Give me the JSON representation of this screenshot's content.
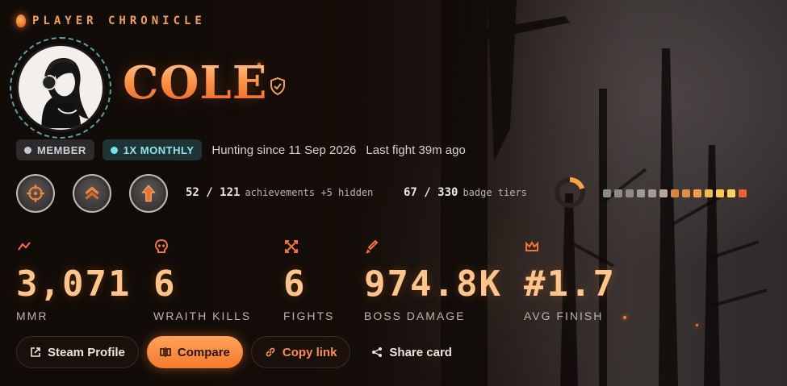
{
  "header": {
    "eyebrow": "PLAYER CHRONICLE"
  },
  "player": {
    "name": "COLE",
    "verified_icon": "shield-check-icon"
  },
  "pills": {
    "member": "MEMBER",
    "monthly": "1X MONTHLY",
    "since": "Hunting since 11 Sep 2026",
    "last_fight": "Last fight 39m ago"
  },
  "badges": [
    {
      "icon": "crosshair-icon"
    },
    {
      "icon": "chevron-rank-icon"
    },
    {
      "icon": "arrow-up-icon"
    }
  ],
  "achievements": {
    "count": "52 / 121",
    "label": "achievements +5 hidden"
  },
  "badge_tiers": {
    "count": "67 / 330",
    "label": "badge tiers",
    "progress": 0.2
  },
  "tier_colors": [
    "#8a8a8a",
    "#8a8a8a",
    "#8f8a88",
    "#9a9a9a",
    "#a39a95",
    "#b3a79a",
    "#d8843e",
    "#e48f40",
    "#f0a040",
    "#f4b945",
    "#f8c94a",
    "#ffd35a",
    "#f25c33"
  ],
  "stats": [
    {
      "icon": "trend-icon",
      "value": "3,071",
      "label": "MMR"
    },
    {
      "icon": "skull-icon",
      "value": "6",
      "label": "WRAITH KILLS"
    },
    {
      "icon": "crossed-swords-icon",
      "value": "6",
      "label": "FIGHTS"
    },
    {
      "icon": "sword-icon",
      "value": "974.8K",
      "label": "BOSS DAMAGE"
    },
    {
      "icon": "crown-icon",
      "value": "#1.7",
      "label": "AVG FINISH"
    }
  ],
  "actions": {
    "steam": "Steam Profile",
    "compare": "Compare",
    "copy": "Copy link",
    "share": "Share card"
  },
  "colors": {
    "accent": "#ff9a4e",
    "accent_dark": "#e35a1f",
    "teal": "#71e2ec"
  }
}
